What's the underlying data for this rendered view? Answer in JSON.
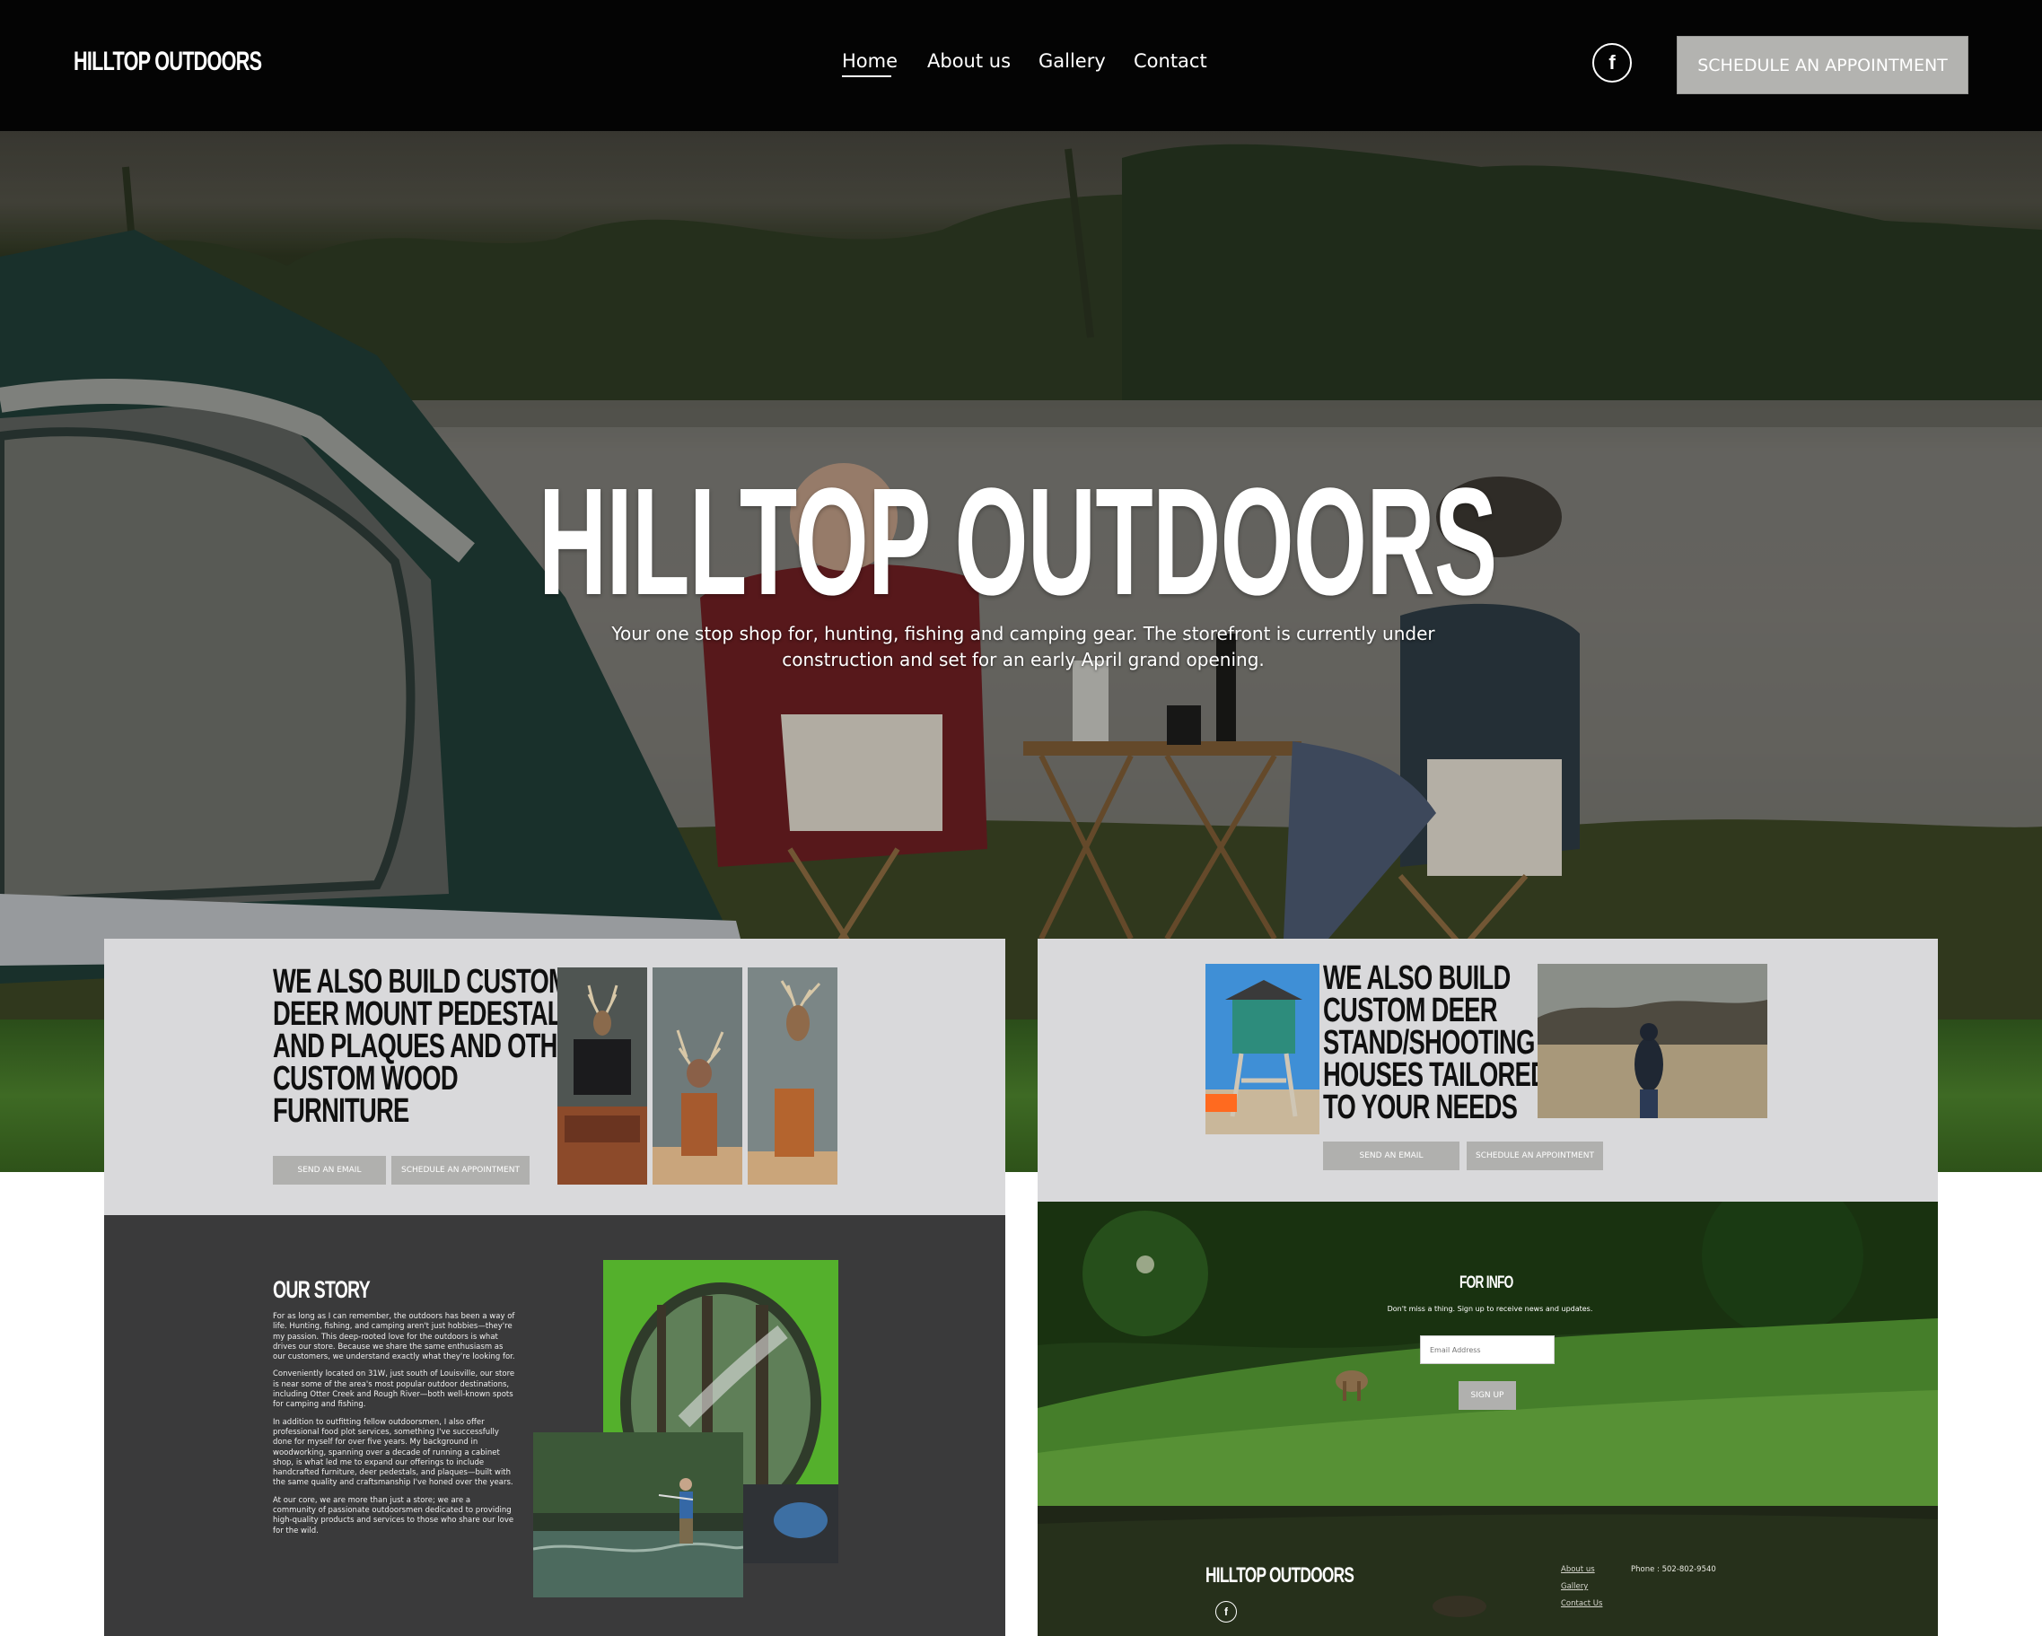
{
  "nav": {
    "logo": "HILLTOP OUTDOORS",
    "links": [
      {
        "label": "Home"
      },
      {
        "label": "About us"
      },
      {
        "label": "Gallery"
      },
      {
        "label": "Contact"
      }
    ],
    "facebook_glyph": "f",
    "cta": "SCHEDULE AN APPOINTMENT"
  },
  "hero": {
    "title": "HILLTOP OUTDOORS",
    "subtitle": "Your one stop shop for, hunting, fishing and camping gear. The storefront is currently under construction and set for an early April grand opening."
  },
  "furniture": {
    "heading_lines": [
      "WE ALSO BUILD CUSTOM",
      "DEER MOUNT PEDESTALS",
      "AND PLAQUES AND OTHER",
      "CUSTOM WOOD",
      "FURNITURE"
    ],
    "email_button": "SEND AN EMAIL",
    "appointment_button": "SCHEDULE AN APPOINTMENT"
  },
  "stands": {
    "heading_lines": [
      "WE ALSO BUILD",
      "CUSTOM DEER",
      "STAND/SHOOTING",
      "HOUSES TAILORED",
      "TO YOUR NEEDS"
    ],
    "email_button": "SEND AN EMAIL",
    "appointment_button": "SCHEDULE AN APPOINTMENT"
  },
  "story": {
    "title": "OUR STORY",
    "paragraphs": [
      "For as long as I can remember, the outdoors has been a way of life. Hunting, fishing, and camping aren't just hobbies—they're my passion. This deep-rooted love for the outdoors is what drives our store. Because we share the same enthusiasm as our customers, we understand exactly what they're looking for.",
      "Conveniently located on 31W, just south of Louisville, our store is near some of the area's most popular outdoor destinations, including Otter Creek and Rough River—both well-known spots for camping and fishing.",
      "In addition to outfitting fellow outdoorsmen, I also offer professional food plot services, something I've successfully done for myself for over five years. My background in woodworking, spanning over a decade of running a cabinet shop, is what led me to expand our offerings to include handcrafted furniture, deer pedestals, and plaques—built with the same quality and craftsmanship I've honed over the years.",
      "At our core, we are more than just a store; we are a community of passionate outdoorsmen dedicated to providing high-quality products and services to those who share our love for the wild."
    ]
  },
  "signup": {
    "title": "FOR INFO",
    "subtitle": "Don't miss a thing. Sign up to receive news and updates.",
    "email_placeholder": "Email Address",
    "button": "SIGN UP"
  },
  "footer": {
    "logo": "HILLTOP OUTDOORS",
    "facebook_glyph": "f",
    "links": [
      "About us",
      "Gallery",
      "Contact Us"
    ],
    "phone": "Phone : 502-802-9540"
  },
  "colors": {
    "nav_bg": "#040404",
    "button_gray": "#b0b0ae",
    "panel_gray": "#d9d9db",
    "story_bg": "#3a3a3b"
  }
}
